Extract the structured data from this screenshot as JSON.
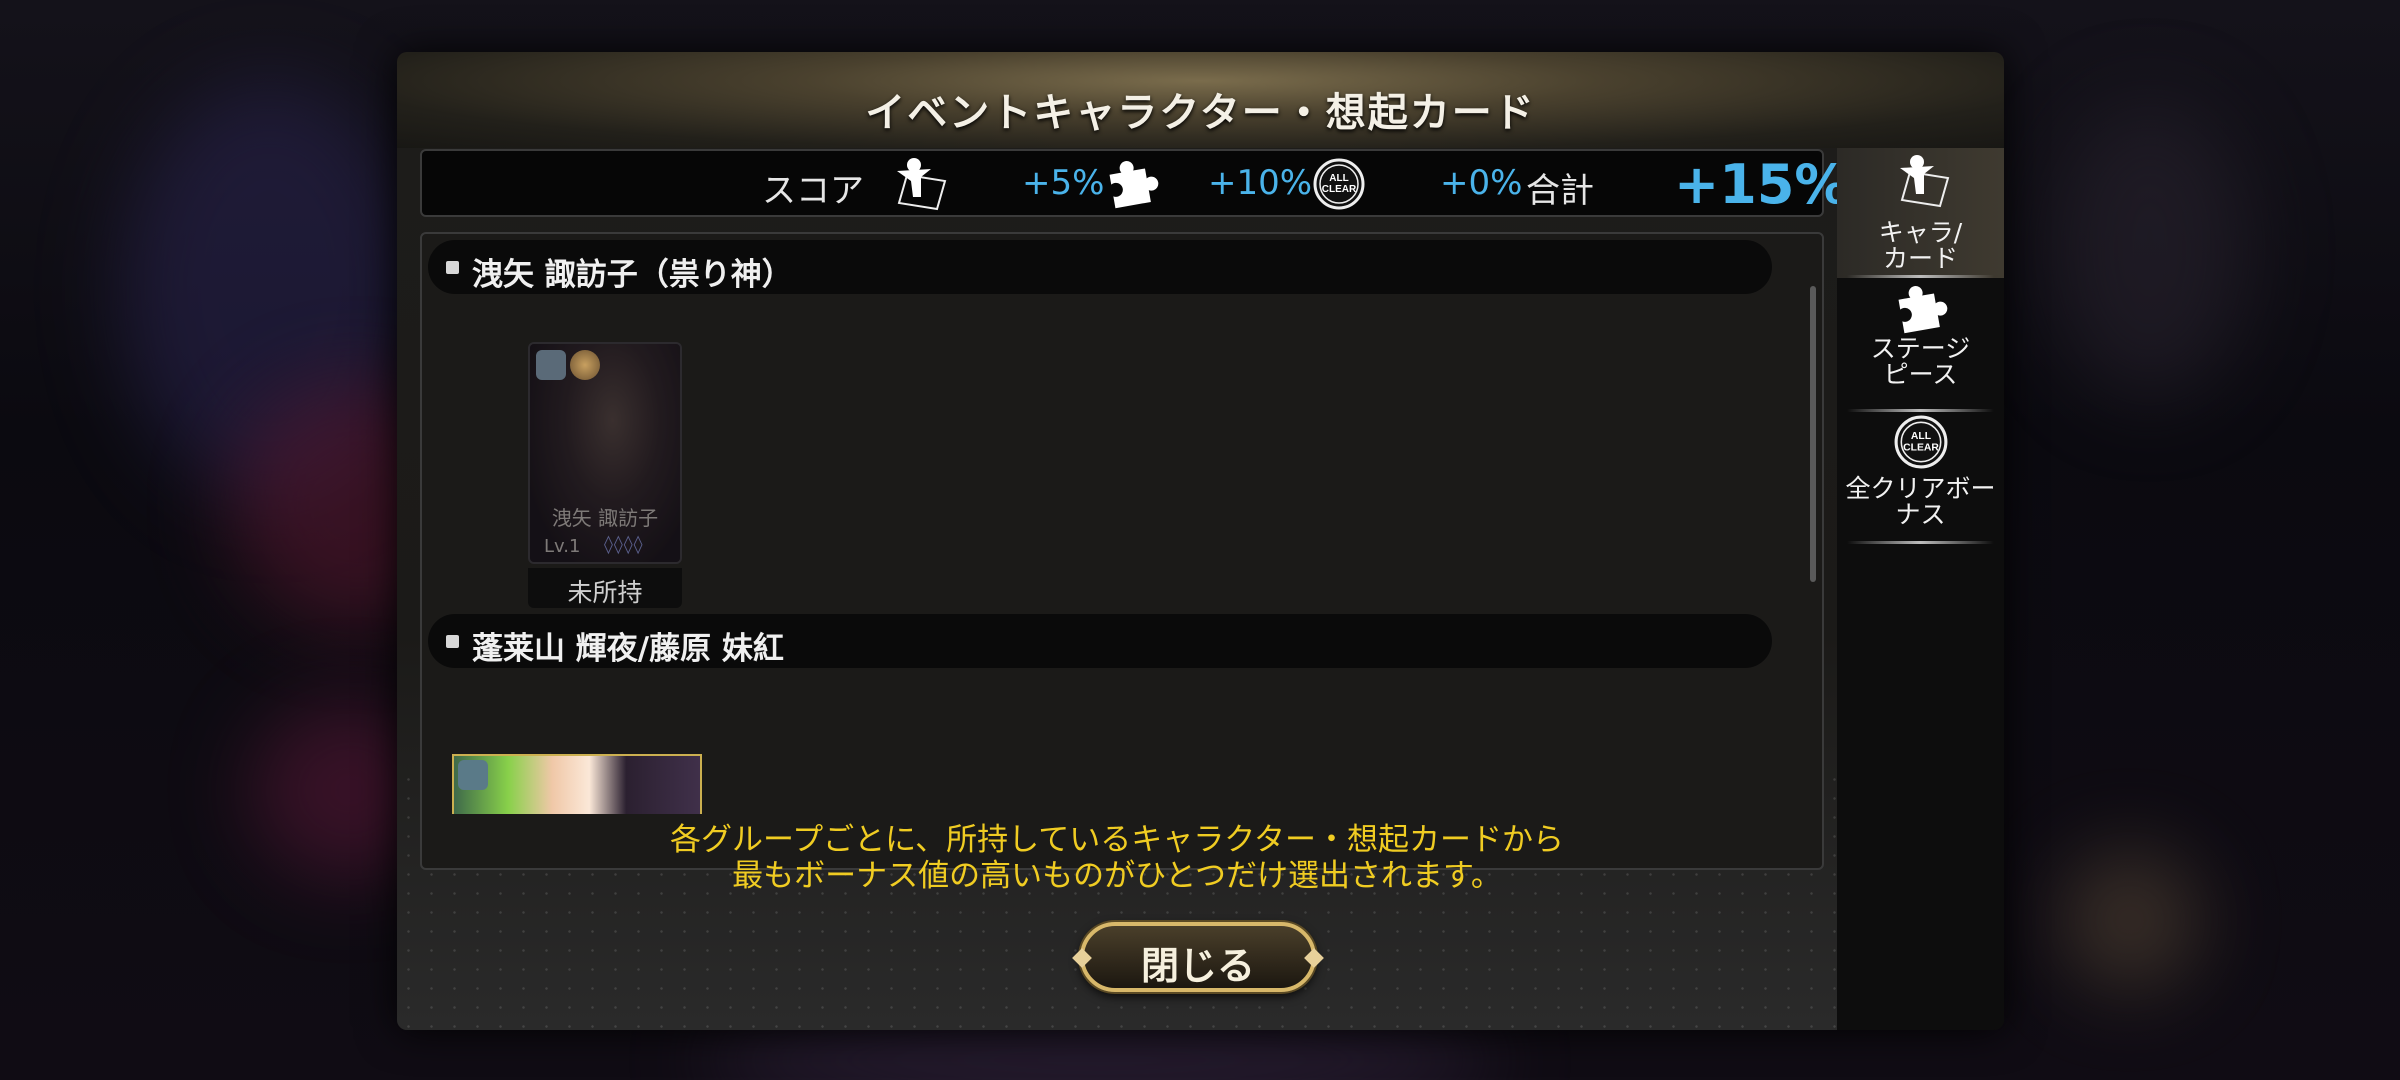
{
  "dialog": {
    "title": "イベントキャラクター・想起カード"
  },
  "score": {
    "label": "スコア",
    "chara_bonus": "+5%",
    "stage_piece_bonus": "+10%",
    "all_clear_bonus": "+0%",
    "total_label": "合計",
    "total_value": "+15%"
  },
  "groups": [
    {
      "label": "洩矢 諏訪子（祟り神）"
    },
    {
      "label": "蓬莱山 輝夜/藤原 妹紅"
    }
  ],
  "card1": {
    "name": "洩矢 諏訪子",
    "level": "Lv.1",
    "gems": "◊◊◊◊",
    "status": "未所持"
  },
  "notice": {
    "line1": "各グループごとに、所持しているキャラクター・想起カードから",
    "line2": "最もボーナス値の高いものがひとつだけ選出されます。"
  },
  "close_button": {
    "label": "閉じる"
  },
  "side_tabs": [
    {
      "label_line1": "キャラ/",
      "label_line2": "カード",
      "icon": "chara-card-icon",
      "active": true
    },
    {
      "label_line1": "ステージ",
      "label_line2": "ピース",
      "icon": "puzzle-piece-icon",
      "active": false
    },
    {
      "label_line1": "全クリアボー",
      "label_line2": "ナス",
      "icon": "all-clear-icon",
      "active": false
    }
  ],
  "icons": {
    "all_clear_text_top": "ALL",
    "all_clear_text_bottom": "CLEAR"
  },
  "colors": {
    "bonus_blue": "#4ab3ea",
    "notice_yellow": "#f0cc22",
    "button_gold": "#d8b86a"
  }
}
